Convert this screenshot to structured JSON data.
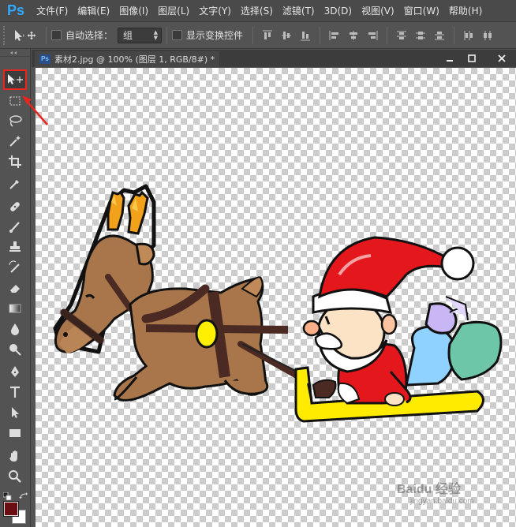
{
  "app": {
    "logo_text": "Ps"
  },
  "menu": {
    "items": [
      {
        "label": "文件(F)"
      },
      {
        "label": "编辑(E)"
      },
      {
        "label": "图像(I)"
      },
      {
        "label": "图层(L)"
      },
      {
        "label": "文字(Y)"
      },
      {
        "label": "选择(S)"
      },
      {
        "label": "滤镜(T)"
      },
      {
        "label": "3D(D)"
      },
      {
        "label": "视图(V)"
      },
      {
        "label": "窗口(W)"
      },
      {
        "label": "帮助(H)"
      }
    ]
  },
  "options": {
    "auto_select_label": "自动选择：",
    "auto_select_value": "组",
    "show_transform_label": "显示变换控件"
  },
  "document": {
    "tab_icon": "Ps",
    "tab_title": "素材2.jpg @ 100% (图层 1, RGB/8#) *"
  },
  "toolbox": {
    "selected_tool": "move-tool",
    "foreground_color": "#6b0e14",
    "background_color": "#ffffff"
  },
  "watermark": {
    "text": "Baidu 经验",
    "url": "jingyan.baidu.com"
  },
  "colors": {
    "highlight": "#e8261d",
    "ps_blue": "#31a8ff"
  }
}
